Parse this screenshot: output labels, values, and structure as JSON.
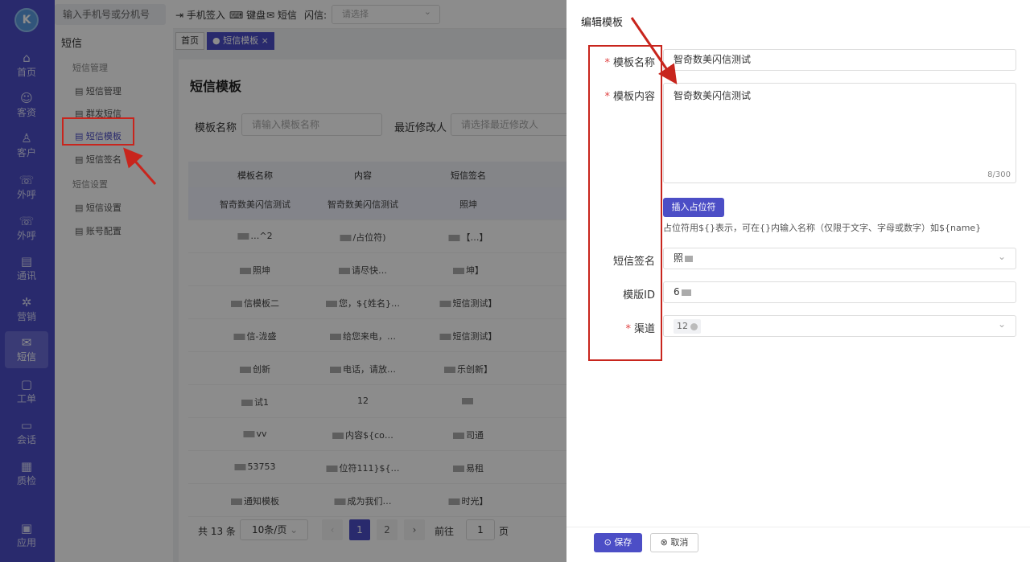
{
  "brand": {
    "logo_text": "K",
    "accent": "#4c4ec6",
    "annotation_color": "#c8251d"
  },
  "rail": {
    "items": [
      {
        "label": "首页",
        "icon": "home-icon",
        "glyph": "⌂"
      },
      {
        "label": "客资",
        "icon": "users-icon",
        "glyph": "☺"
      },
      {
        "label": "客户",
        "icon": "person-icon",
        "glyph": "♙"
      },
      {
        "label": "外呼",
        "icon": "phone-icon",
        "glyph": "☏"
      },
      {
        "label": "外呼",
        "icon": "phone-out-icon",
        "glyph": "☏"
      },
      {
        "label": "通讯",
        "icon": "contacts-icon",
        "glyph": "▤"
      },
      {
        "label": "营销",
        "icon": "marketing-icon",
        "glyph": "✲"
      },
      {
        "label": "短信",
        "icon": "sms-icon",
        "glyph": "✉"
      },
      {
        "label": "工单",
        "icon": "ticket-icon",
        "glyph": "▢"
      },
      {
        "label": "会话",
        "icon": "chat-icon",
        "glyph": "▭"
      },
      {
        "label": "质检",
        "icon": "inspect-icon",
        "glyph": "▦"
      },
      {
        "label": "应用",
        "icon": "apps-icon",
        "glyph": "▣"
      }
    ]
  },
  "sidebar": {
    "title": "短信",
    "group1": "短信管理",
    "items1": [
      "短信管理",
      "群发短信",
      "短信模板",
      "短信签名"
    ],
    "group2": "短信设置",
    "items2": [
      "短信设置",
      "账号配置"
    ]
  },
  "topbar": {
    "search_placeholder": "输入手机号或分机号",
    "links": [
      "手机签入",
      "键盘",
      "短信"
    ],
    "flash_label": "闪信:",
    "flash_placeholder": "请选择"
  },
  "tabs": [
    "首页",
    "短信模板"
  ],
  "page": {
    "title": "短信模板",
    "filter_name_label": "模板名称",
    "filter_name_placeholder": "请输入模板名称",
    "filter_modifier_label": "最近修改人",
    "filter_modifier_placeholder": "请选择最近修改人"
  },
  "table": {
    "columns": [
      "模板名称",
      "内容",
      "短信签名"
    ],
    "rows": [
      [
        "智奇数美闪信测试",
        "智奇数美闪信测试",
        "照坤"
      ],
      [
        "…^2",
        "/占位符)",
        "【…】"
      ],
      [
        "照坤",
        "请尽快…",
        "坤】"
      ],
      [
        "信模板二",
        "您，${姓名}…",
        "短信测试】"
      ],
      [
        "信-泷盛",
        "给您来电，…",
        "短信测试】"
      ],
      [
        "创新",
        "电话，请放…",
        "乐创新】"
      ],
      [
        "试1",
        "12",
        ""
      ],
      [
        "vv",
        "内容${co…",
        "司通"
      ],
      [
        "53753",
        "位符111}${…",
        "易租"
      ],
      [
        "通知模板",
        "成为我们…",
        "时光】"
      ]
    ]
  },
  "pager": {
    "total": "共 13 条",
    "size": "10条/页",
    "pages": [
      "1",
      "2"
    ],
    "goto": "前往",
    "page_input": "1",
    "page_suffix": "页"
  },
  "drawer": {
    "title": "编辑模板",
    "name_label": "模板名称",
    "name_value": "智奇数美闪信测试",
    "content_label": "模板内容",
    "content_value": "智奇数美闪信测试",
    "content_count": "8/300",
    "insert_button": "插入占位符",
    "hint": "占位符用${}表示，可在{}内输入名称（仅限于文字、字母或数字）如${name}",
    "signature_label": "短信签名",
    "signature_value": "照",
    "template_id_label": "模版ID",
    "template_id_value": "6",
    "channel_label": "渠道",
    "channel_tag": "12",
    "save_button": "保存",
    "cancel_button": "取消"
  }
}
